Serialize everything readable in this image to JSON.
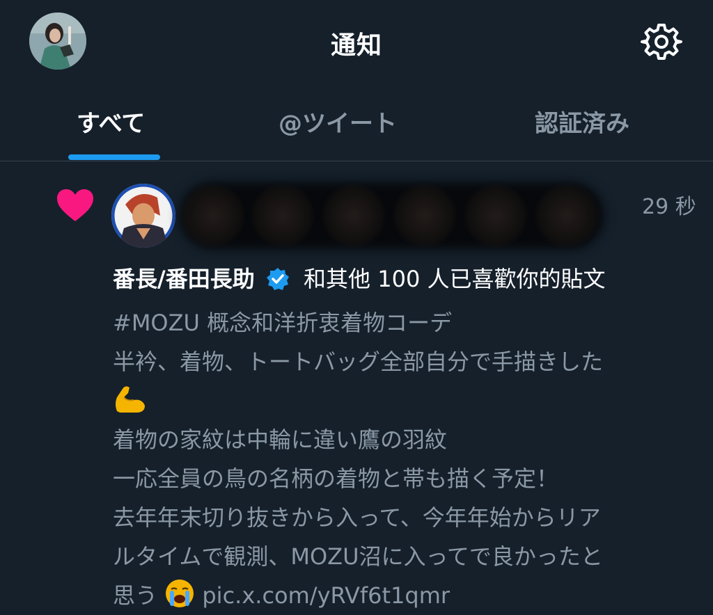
{
  "header": {
    "title": "通知",
    "avatar_icon": "user-avatar",
    "settings_icon": "gear-icon"
  },
  "tabs": [
    {
      "label": "すべて",
      "active": true
    },
    {
      "label": "@ツイート",
      "active": false
    },
    {
      "label": "認証済み",
      "active": false
    }
  ],
  "notification": {
    "icon": "heart-icon",
    "time": "29 秒",
    "liker_name": "番長/番田長助",
    "liked_text": "和其他 100 人已喜歡你的貼文",
    "tweet": {
      "lines": [
        "#MOZU 概念和洋折衷着物コーデ",
        "半衿、着物、トートバッグ全部自分で手描きした"
      ],
      "lines2": [
        "着物の家紋は中輪に違い鷹の羽紋",
        "一応全員の鳥の名柄の着物と帯も描く予定！",
        "去年年末切り抜きから入って、今年年始からリア",
        "ルタイムで観測、MOZU沼に入ってで良かったと"
      ],
      "last_prefix": "思う",
      "link": "pic.x.com/yRVf6t1qmr"
    }
  },
  "colors": {
    "background": "#15202b",
    "accent": "#1d9bf0",
    "heart": "#f91880",
    "muted": "#8b98a5"
  }
}
